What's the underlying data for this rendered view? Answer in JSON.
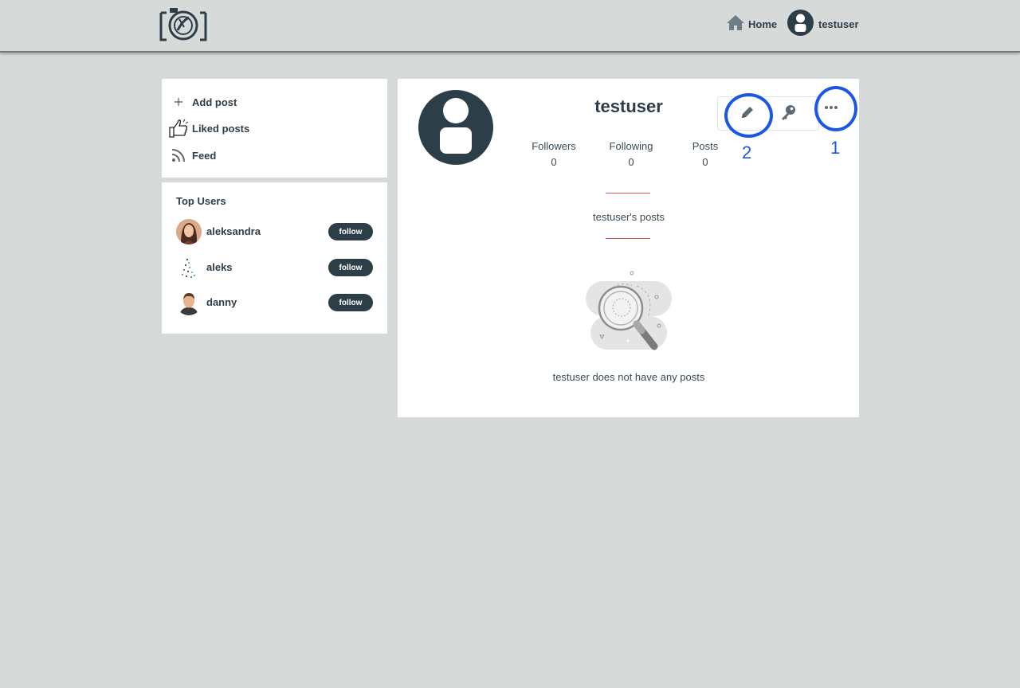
{
  "header": {
    "home_label": "Home",
    "username": "testuser"
  },
  "menu": {
    "items": [
      {
        "label": "Add post",
        "icon": "plus-icon"
      },
      {
        "label": "Liked posts",
        "icon": "thumbs-up-icon"
      },
      {
        "label": "Feed",
        "icon": "rss-feed-icon"
      }
    ]
  },
  "top_users": {
    "title": "Top Users",
    "users": [
      {
        "name": "aleksandra",
        "button": "follow"
      },
      {
        "name": "aleks",
        "button": "follow"
      },
      {
        "name": "danny",
        "button": "follow"
      }
    ]
  },
  "profile": {
    "username": "testuser",
    "stats": [
      {
        "label": "Followers",
        "value": "0"
      },
      {
        "label": "Following",
        "value": "0"
      },
      {
        "label": "Posts",
        "value": "0"
      }
    ],
    "posts_title": "testuser's posts",
    "empty_message": "testuser does not have any posts"
  },
  "annotations": {
    "first": "1",
    "second": "2",
    "color": "#1a57e6"
  },
  "colors": {
    "background": "#d6dbda",
    "dark": "#2c3e48",
    "accent_divider": "#d9534f"
  }
}
